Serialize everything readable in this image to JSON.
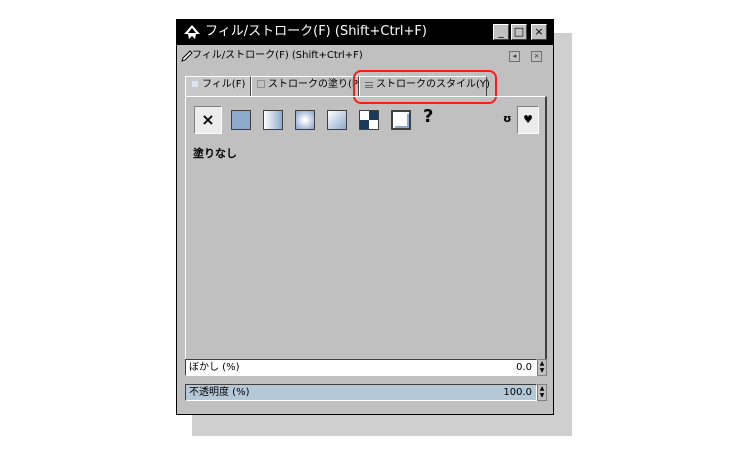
{
  "window": {
    "title": "フィル/ストローク(F) (Shift+Ctrl+F)",
    "controls": {
      "minimize": "_",
      "maximize": "□",
      "close": "×"
    }
  },
  "dialog": {
    "title": "フィル/ストローク(F) (Shift+Ctrl+F)",
    "controls": {
      "menu": "◂",
      "close": "×"
    }
  },
  "tabs": [
    {
      "label": "フィル(F)"
    },
    {
      "label": "ストロークの塗り(P)"
    },
    {
      "label": "ストロークのスタイル(Y)"
    }
  ],
  "highlight_color": "#ff1a1a",
  "paint_buttons": [
    {
      "icon": "none-x-icon",
      "text": "×"
    },
    {
      "icon": "flat-color-icon"
    },
    {
      "icon": "linear-gradient-icon"
    },
    {
      "icon": "radial-gradient-icon"
    },
    {
      "icon": "mesh-icon"
    },
    {
      "icon": "pattern-icon"
    },
    {
      "icon": "swatch-icon"
    },
    {
      "icon": "unset-icon",
      "text": "?"
    }
  ],
  "fill_rules": {
    "evenodd": "ʊ",
    "nonzero": "♥"
  },
  "fill_status": "塗りなし",
  "blur": {
    "label": "ぼかし (%)",
    "value": "0.0"
  },
  "opacity": {
    "label": "不透明度 (%)",
    "value": "100.0"
  },
  "spin_arrows": {
    "up": "▲",
    "down": "▼"
  }
}
